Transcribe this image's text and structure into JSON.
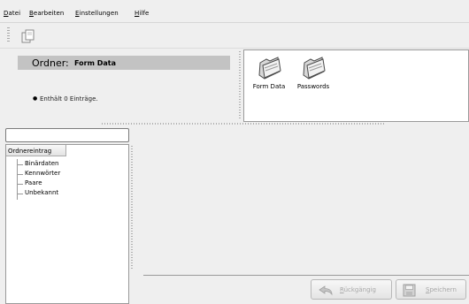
{
  "menu": {
    "items": [
      {
        "label": "Datei"
      },
      {
        "label": "Bearbeiten"
      },
      {
        "label": "Einstellungen"
      },
      {
        "label": "Hilfe"
      }
    ]
  },
  "toolbar": {
    "copy_icon": "copy-icon"
  },
  "info": {
    "folder_label": "Ordner:",
    "folder_name": "Form Data",
    "entries_text": "Enthält 0 Einträge."
  },
  "icon_view": {
    "items": [
      {
        "label": "Form Data",
        "icon": "folder-icon"
      },
      {
        "label": "Passwords",
        "icon": "folder-icon"
      }
    ]
  },
  "search": {
    "value": "",
    "placeholder": ""
  },
  "tree": {
    "header": "Ordnereintrag",
    "items": [
      {
        "label": "Binärdaten"
      },
      {
        "label": "Kennwörter"
      },
      {
        "label": "Paare"
      },
      {
        "label": "Unbekannt"
      }
    ]
  },
  "actions": {
    "undo_label": "Rückgängig",
    "save_label": "Speichern"
  },
  "colors": {
    "window_bg": "#efefef",
    "header_bar": "#c3c3c3",
    "disabled_text": "#a8a8a8"
  }
}
